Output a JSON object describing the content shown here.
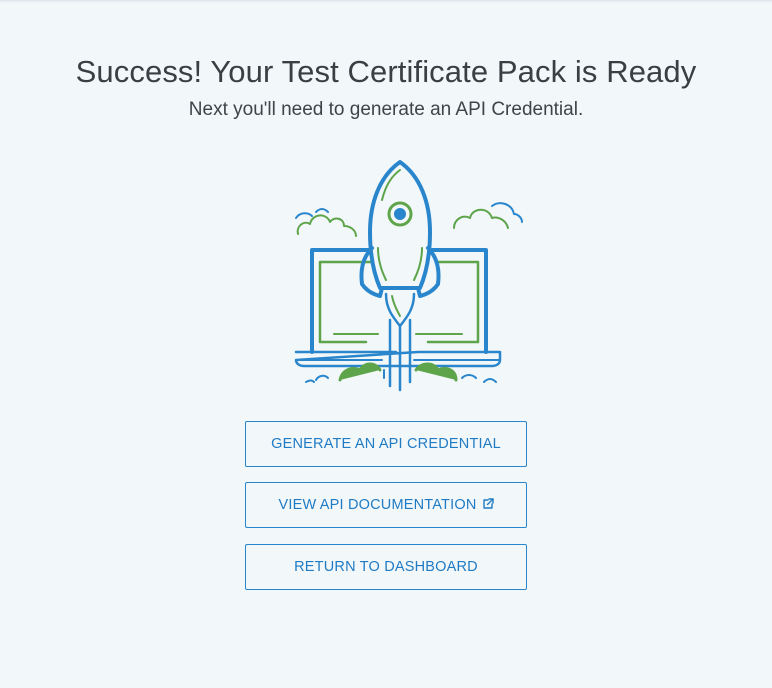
{
  "page": {
    "title": "Success! Your Test Certificate Pack is Ready",
    "subtitle": "Next you'll need to generate an API Credential."
  },
  "illustration": {
    "icon": "rocket-launch-from-laptop-icon",
    "colors": {
      "primary_blue": "#2a86cc",
      "accent_green": "#5ea44a"
    }
  },
  "actions": {
    "generate_label": "GENERATE AN API CREDENTIAL",
    "docs_label": "VIEW API DOCUMENTATION",
    "docs_icon": "external-link-icon",
    "dashboard_label": "RETURN TO DASHBOARD"
  },
  "colors": {
    "background": "#f2f7fa",
    "button_border": "#2a86cc",
    "button_text": "#1f7bc4",
    "heading_text": "#3a3f44"
  }
}
